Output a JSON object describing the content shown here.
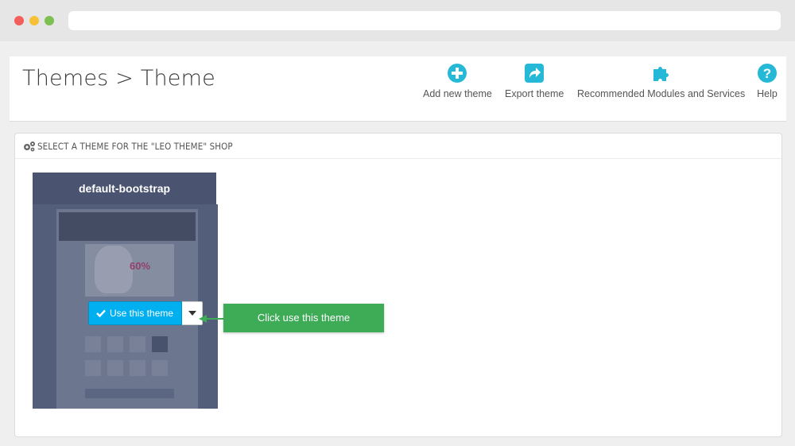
{
  "header": {
    "title": "Themes > Theme"
  },
  "toolbar": {
    "buttons": [
      {
        "label": "Add new theme",
        "icon": "plus-circle-icon"
      },
      {
        "label": "Export theme",
        "icon": "share-icon"
      },
      {
        "label": "Recommended Modules and Services",
        "icon": "puzzle-icon"
      },
      {
        "label": "Help",
        "icon": "question-circle-icon"
      }
    ]
  },
  "panel": {
    "heading": "SELECT A THEME FOR THE \"LEO THEME\" SHOP",
    "icon": "gears-icon"
  },
  "theme_card": {
    "name": "default-bootstrap",
    "use_button_label": "Use this theme",
    "preview_sale_text": "60%"
  },
  "callout": {
    "text": "Click use this theme"
  },
  "colors": {
    "accent": "#00aff0",
    "callout": "#3eab57",
    "card_header": "#4a5470"
  }
}
